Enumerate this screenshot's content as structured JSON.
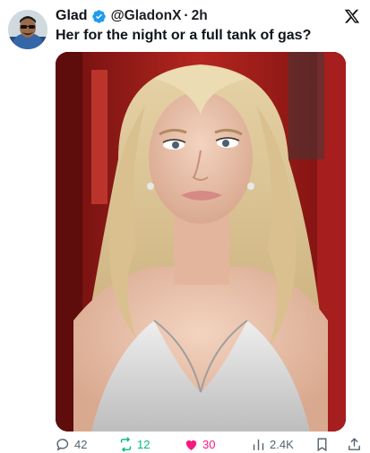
{
  "author": {
    "name": "Glad",
    "handle": "@GladonX",
    "separator": "·",
    "time": "2h",
    "verified": true
  },
  "tweet": {
    "text": "Her for the night or a full tank of gas?"
  },
  "media": {
    "description_icon": "photo"
  },
  "actions": {
    "reply_count": "42",
    "retweet_count": "12",
    "like_count": "30",
    "views_count": "2.4K"
  },
  "colors": {
    "verified": "#1d9bf0",
    "retweet": "#00ba7c",
    "like": "#f91880",
    "muted": "#536471"
  }
}
